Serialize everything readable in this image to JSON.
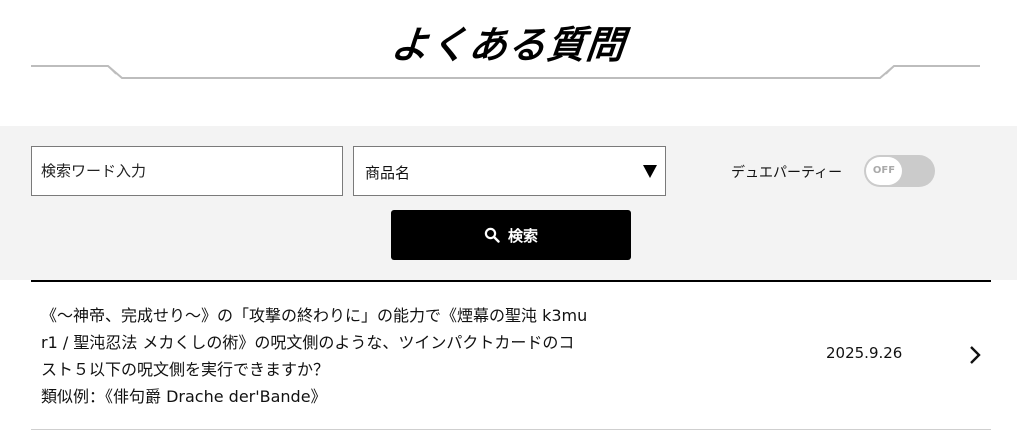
{
  "page": {
    "title": "よくある質問"
  },
  "search": {
    "keyword_placeholder": "検索ワード入力",
    "keyword_value": "",
    "product_select_value": "商品名",
    "toggle_label": "デュエパーティー",
    "toggle_state_label": "OFF",
    "toggle_on": false,
    "button_label": "検索"
  },
  "faq_items": [
    {
      "question_lines": [
        "《～神帝、完成せり～》の「攻撃の終わりに」の能力で《煙幕の聖沌 k3mu",
        "r1 / 聖沌忍法 メカくしの術》の呪文側のような、ツインパクトカードのコ",
        "スト５以下の呪文側を実行できますか？",
        "類似例：《俳句爵 Drache der'Bande》"
      ],
      "date": "2025.9.26"
    }
  ],
  "colors": {
    "button_bg": "#000000",
    "panel_bg": "#f3f3f3",
    "toggle_off_bg": "#cbcbcb"
  },
  "icons": {
    "search": "search-icon",
    "select_arrow": "select-arrow-icon",
    "row_chevron": "chevron-right-icon"
  }
}
